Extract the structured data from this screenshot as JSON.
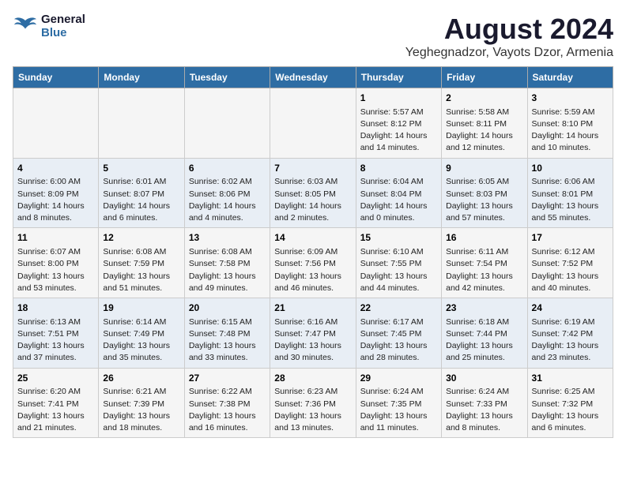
{
  "logo": {
    "line1": "General",
    "line2": "Blue"
  },
  "title": "August 2024",
  "subtitle": "Yeghegnadzor, Vayots Dzor, Armenia",
  "weekdays": [
    "Sunday",
    "Monday",
    "Tuesday",
    "Wednesday",
    "Thursday",
    "Friday",
    "Saturday"
  ],
  "weeks": [
    [
      {
        "day": "",
        "info": ""
      },
      {
        "day": "",
        "info": ""
      },
      {
        "day": "",
        "info": ""
      },
      {
        "day": "",
        "info": ""
      },
      {
        "day": "1",
        "info": "Sunrise: 5:57 AM\nSunset: 8:12 PM\nDaylight: 14 hours\nand 14 minutes."
      },
      {
        "day": "2",
        "info": "Sunrise: 5:58 AM\nSunset: 8:11 PM\nDaylight: 14 hours\nand 12 minutes."
      },
      {
        "day": "3",
        "info": "Sunrise: 5:59 AM\nSunset: 8:10 PM\nDaylight: 14 hours\nand 10 minutes."
      }
    ],
    [
      {
        "day": "4",
        "info": "Sunrise: 6:00 AM\nSunset: 8:09 PM\nDaylight: 14 hours\nand 8 minutes."
      },
      {
        "day": "5",
        "info": "Sunrise: 6:01 AM\nSunset: 8:07 PM\nDaylight: 14 hours\nand 6 minutes."
      },
      {
        "day": "6",
        "info": "Sunrise: 6:02 AM\nSunset: 8:06 PM\nDaylight: 14 hours\nand 4 minutes."
      },
      {
        "day": "7",
        "info": "Sunrise: 6:03 AM\nSunset: 8:05 PM\nDaylight: 14 hours\nand 2 minutes."
      },
      {
        "day": "8",
        "info": "Sunrise: 6:04 AM\nSunset: 8:04 PM\nDaylight: 14 hours\nand 0 minutes."
      },
      {
        "day": "9",
        "info": "Sunrise: 6:05 AM\nSunset: 8:03 PM\nDaylight: 13 hours\nand 57 minutes."
      },
      {
        "day": "10",
        "info": "Sunrise: 6:06 AM\nSunset: 8:01 PM\nDaylight: 13 hours\nand 55 minutes."
      }
    ],
    [
      {
        "day": "11",
        "info": "Sunrise: 6:07 AM\nSunset: 8:00 PM\nDaylight: 13 hours\nand 53 minutes."
      },
      {
        "day": "12",
        "info": "Sunrise: 6:08 AM\nSunset: 7:59 PM\nDaylight: 13 hours\nand 51 minutes."
      },
      {
        "day": "13",
        "info": "Sunrise: 6:08 AM\nSunset: 7:58 PM\nDaylight: 13 hours\nand 49 minutes."
      },
      {
        "day": "14",
        "info": "Sunrise: 6:09 AM\nSunset: 7:56 PM\nDaylight: 13 hours\nand 46 minutes."
      },
      {
        "day": "15",
        "info": "Sunrise: 6:10 AM\nSunset: 7:55 PM\nDaylight: 13 hours\nand 44 minutes."
      },
      {
        "day": "16",
        "info": "Sunrise: 6:11 AM\nSunset: 7:54 PM\nDaylight: 13 hours\nand 42 minutes."
      },
      {
        "day": "17",
        "info": "Sunrise: 6:12 AM\nSunset: 7:52 PM\nDaylight: 13 hours\nand 40 minutes."
      }
    ],
    [
      {
        "day": "18",
        "info": "Sunrise: 6:13 AM\nSunset: 7:51 PM\nDaylight: 13 hours\nand 37 minutes."
      },
      {
        "day": "19",
        "info": "Sunrise: 6:14 AM\nSunset: 7:49 PM\nDaylight: 13 hours\nand 35 minutes."
      },
      {
        "day": "20",
        "info": "Sunrise: 6:15 AM\nSunset: 7:48 PM\nDaylight: 13 hours\nand 33 minutes."
      },
      {
        "day": "21",
        "info": "Sunrise: 6:16 AM\nSunset: 7:47 PM\nDaylight: 13 hours\nand 30 minutes."
      },
      {
        "day": "22",
        "info": "Sunrise: 6:17 AM\nSunset: 7:45 PM\nDaylight: 13 hours\nand 28 minutes."
      },
      {
        "day": "23",
        "info": "Sunrise: 6:18 AM\nSunset: 7:44 PM\nDaylight: 13 hours\nand 25 minutes."
      },
      {
        "day": "24",
        "info": "Sunrise: 6:19 AM\nSunset: 7:42 PM\nDaylight: 13 hours\nand 23 minutes."
      }
    ],
    [
      {
        "day": "25",
        "info": "Sunrise: 6:20 AM\nSunset: 7:41 PM\nDaylight: 13 hours\nand 21 minutes."
      },
      {
        "day": "26",
        "info": "Sunrise: 6:21 AM\nSunset: 7:39 PM\nDaylight: 13 hours\nand 18 minutes."
      },
      {
        "day": "27",
        "info": "Sunrise: 6:22 AM\nSunset: 7:38 PM\nDaylight: 13 hours\nand 16 minutes."
      },
      {
        "day": "28",
        "info": "Sunrise: 6:23 AM\nSunset: 7:36 PM\nDaylight: 13 hours\nand 13 minutes."
      },
      {
        "day": "29",
        "info": "Sunrise: 6:24 AM\nSunset: 7:35 PM\nDaylight: 13 hours\nand 11 minutes."
      },
      {
        "day": "30",
        "info": "Sunrise: 6:24 AM\nSunset: 7:33 PM\nDaylight: 13 hours\nand 8 minutes."
      },
      {
        "day": "31",
        "info": "Sunrise: 6:25 AM\nSunset: 7:32 PM\nDaylight: 13 hours\nand 6 minutes."
      }
    ]
  ]
}
